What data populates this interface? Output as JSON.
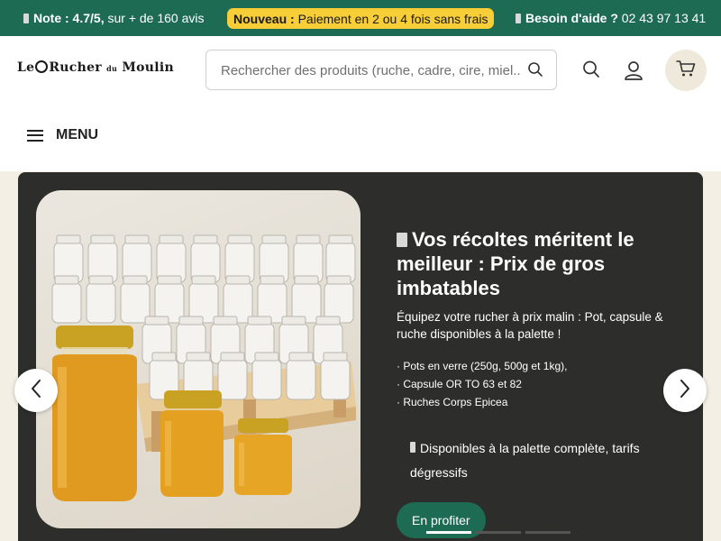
{
  "topbar": {
    "note_label": "Note : 4.7/5,",
    "note_rest": "sur + de 160 avis",
    "new_label": "Nouveau :",
    "new_rest": "Paiement en 2 ou 4 fois sans frais",
    "help_label": "Besoin d'aide ?",
    "help_phone": "02 43 97 13 41"
  },
  "header": {
    "logo": {
      "le": "Le",
      "rucher": "Rucher",
      "du": "du",
      "moulin": "Moulin"
    },
    "search_placeholder": "Rechercher des produits (ruche, cadre, cire, miel...)",
    "menu_label": "MENU",
    "icons": [
      "search-icon",
      "user-icon",
      "cart-icon",
      "hamburger-icon"
    ]
  },
  "hero": {
    "title": "Vos récoltes méritent le meilleur : Prix de gros imbatables",
    "subtitle": "Équipez votre rucher à prix malin : Pot, capsule & ruche disponibles à la palette !",
    "list": [
      "Pots en verre (250g, 500g et 1kg),",
      "Capsule OR TO 63 et 82",
      "Ruches Corps Epicea"
    ],
    "availability": "Disponibles à la palette complète, tarifs dégressifs",
    "cta": "En profiter",
    "slide_count": 3,
    "active_slide": 1
  },
  "colors": {
    "brand_green": "#1d6b53",
    "accent_yellow": "#f7cd38",
    "hero_bg": "#2d2d2b",
    "cream": "#f3efe4"
  }
}
